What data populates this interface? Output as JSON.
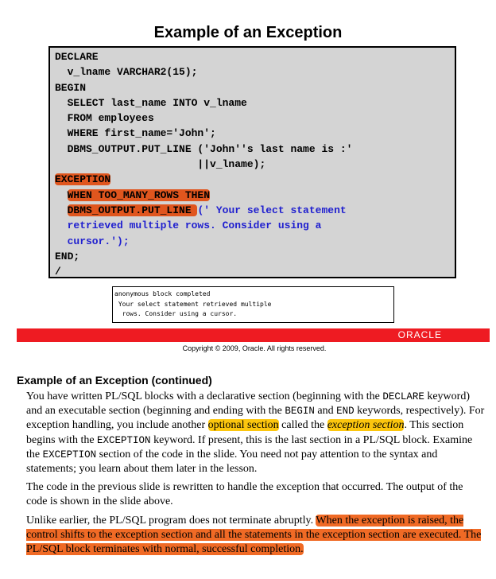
{
  "slide": {
    "title": "Example of an Exception",
    "code": {
      "line1": "DECLARE",
      "line2": "  v_lname VARCHAR2(15);",
      "line3": "BEGIN",
      "line4": "  SELECT last_name INTO v_lname",
      "line5": "  FROM employees",
      "line6": "  WHERE first_name='John';",
      "line7": "  DBMS_OUTPUT.PUT_LINE ('John''s last name is :'",
      "line8": "                       ||v_lname);",
      "line9_exception": "EXCEPTION",
      "line10_when": "WHEN TOO_MANY_ROWS THEN",
      "line11_dbms": "DBMS_OUTPUT.PUT_LINE ",
      "line11_string": "(' Your select statement",
      "line12": "  retrieved multiple rows. Consider using a",
      "line13": "  cursor.');",
      "line14": "END;",
      "line15": "/"
    },
    "output": {
      "line1": "anonymous block completed",
      "line2": " Your select statement retrieved multiple",
      "line3": "  rows. Consider using a cursor."
    },
    "brand": "ORACLE",
    "copyright": "Copyright © 2009, Oracle. All rights reserved."
  },
  "notes": {
    "title": "Example of an Exception (continued)",
    "p1": {
      "t1": "You have written PL/SQL blocks with a declarative section (beginning with the ",
      "k1": "DECLARE",
      "t2": " keyword) and an executable section (beginning and ending with the ",
      "k2": "BEGIN",
      "t3": " and ",
      "k3": "END",
      "t4": " keywords, respectively). For exception handling, you include another ",
      "h1": "optional section",
      "t5": " called the ",
      "h2": "exception section",
      "t6": ". This section begins with the ",
      "k4": "EXCEPTION",
      "t7": " keyword. If present, this is the last section in a PL/SQL block. Examine the ",
      "k5": "EXCEPTION",
      "t8": " section of the code in the slide. You need not pay attention to the syntax and statements; you learn about them later in the lesson."
    },
    "p2": "The code in the previous slide is rewritten to handle the exception that occurred. The output of the code is shown in the slide above.",
    "p3": {
      "t1": "Unlike earlier, the PL/SQL program does not terminate abruptly. ",
      "h1": "When the exception is raised, the control shifts to the exception section and all the statements in the exception section are executed. The PL/SQL block terminates with normal, successful completion."
    }
  },
  "colors": {
    "code_highlight": "#e0561e",
    "string_literal": "#1f1fcf",
    "brand_bar": "#ee1b22",
    "yellow_highlight": "#fcc60e",
    "orange_highlight": "#f06a25"
  }
}
